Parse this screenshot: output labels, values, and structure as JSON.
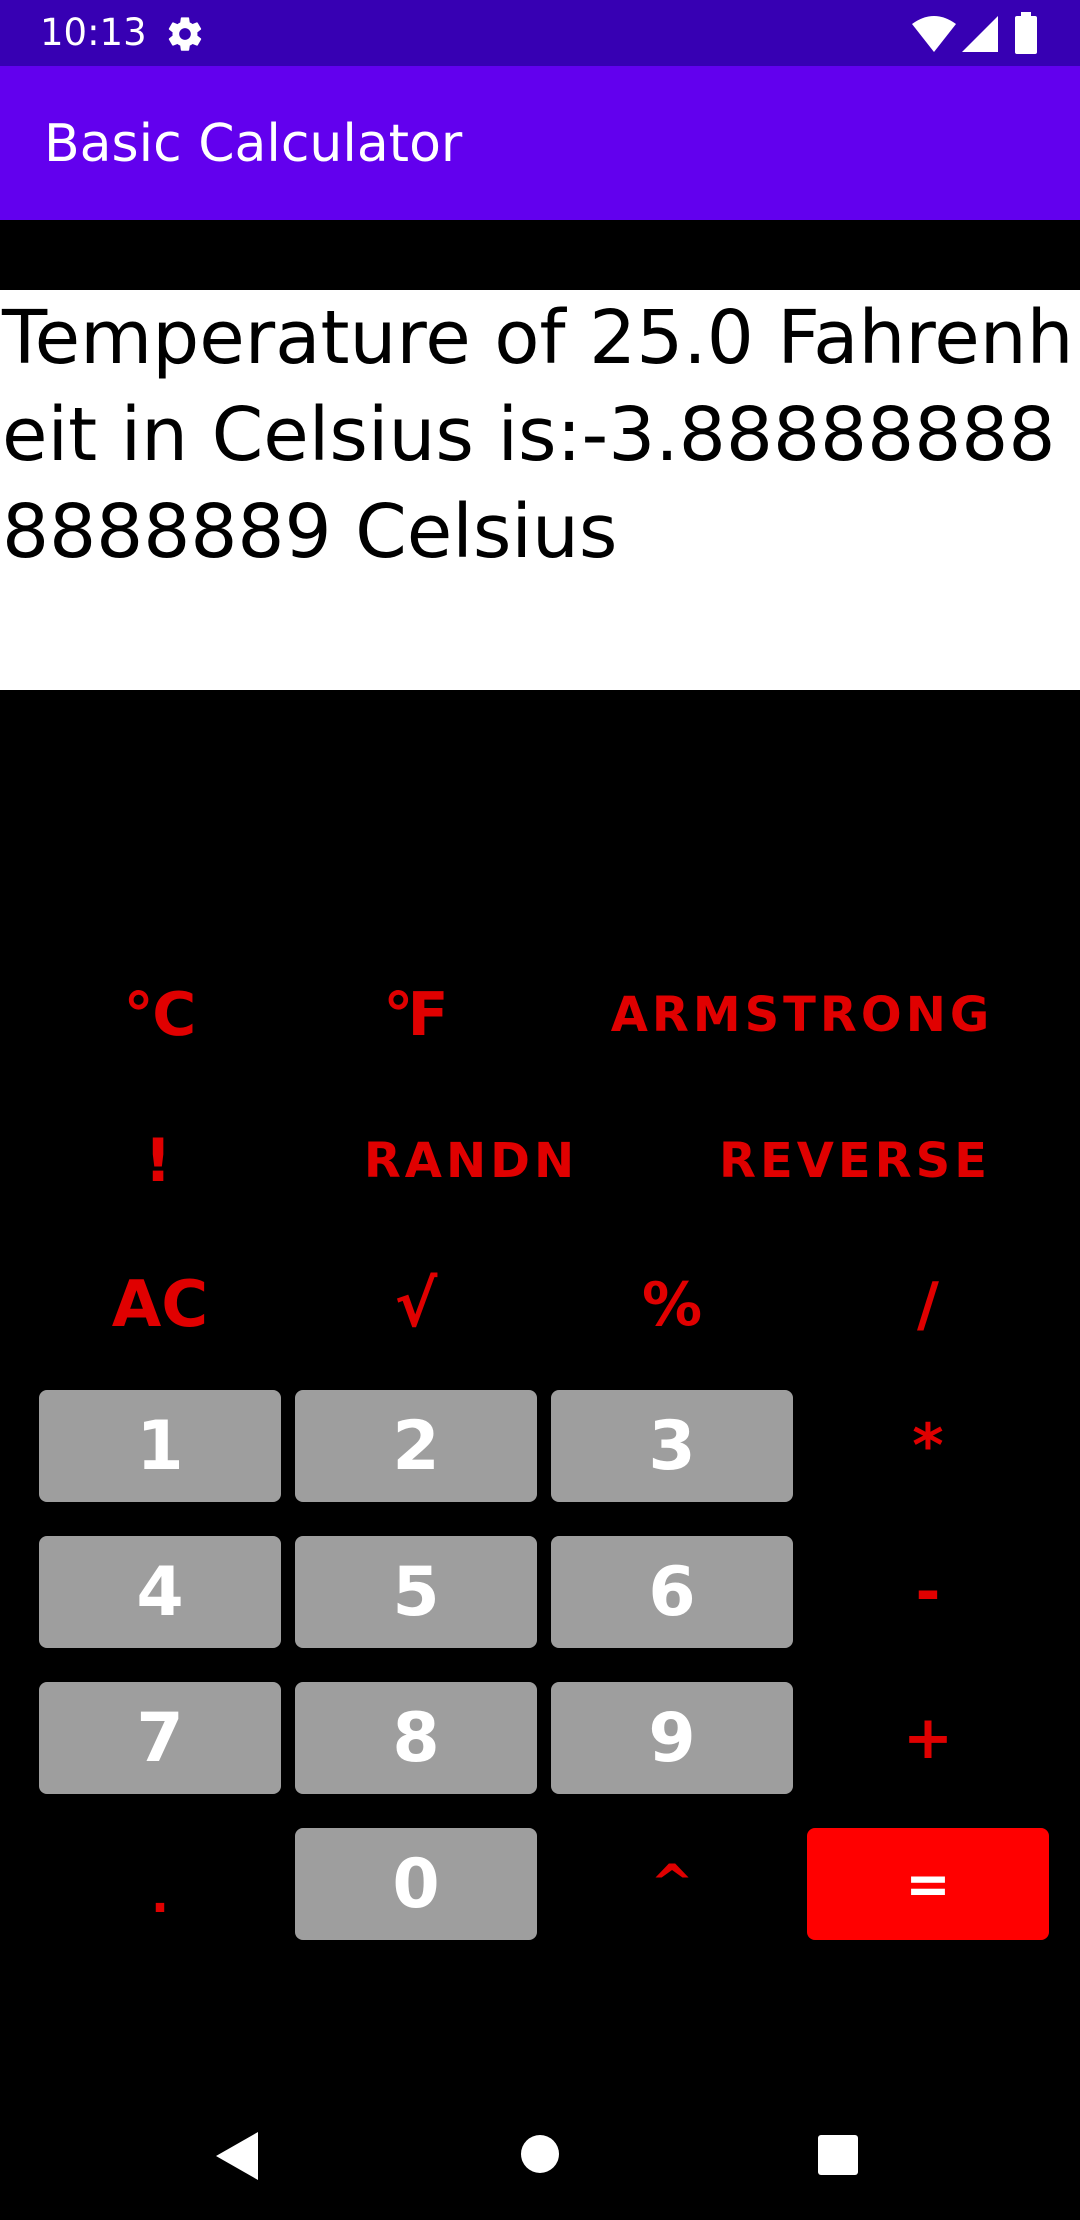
{
  "status_bar": {
    "time": "10:13",
    "icons": [
      "gear-icon",
      "wifi-icon",
      "signal-icon",
      "battery-icon"
    ]
  },
  "app_bar": {
    "title": "Basic Calculator"
  },
  "result": {
    "text": "Temperature of 25.0 Fahrenheit in Celsius is:-3.888888888888889 Celsius"
  },
  "keys": {
    "celsius": "℃",
    "fahrenheit": "℉",
    "armstrong": "ARMSTRONG",
    "factorial": "!",
    "randn": "RANDN",
    "reverse": "REVERSE",
    "ac": "AC",
    "sqrt": "√",
    "percent": "%",
    "divide": "/",
    "one": "1",
    "two": "2",
    "three": "3",
    "multiply": "*",
    "four": "4",
    "five": "5",
    "six": "6",
    "minus": "-",
    "seven": "7",
    "eight": "8",
    "nine": "9",
    "plus": "+",
    "dot": ".",
    "zero": "0",
    "power": "^",
    "equals": "="
  },
  "colors": {
    "status_bar": "#3700B3",
    "app_bar": "#6200EE",
    "text_key": "#e00000",
    "digit_key": "#9e9e9e",
    "equals_key": "#ff0000"
  },
  "nav_bar": {
    "icons": [
      "back-icon",
      "home-icon",
      "recents-icon"
    ]
  }
}
